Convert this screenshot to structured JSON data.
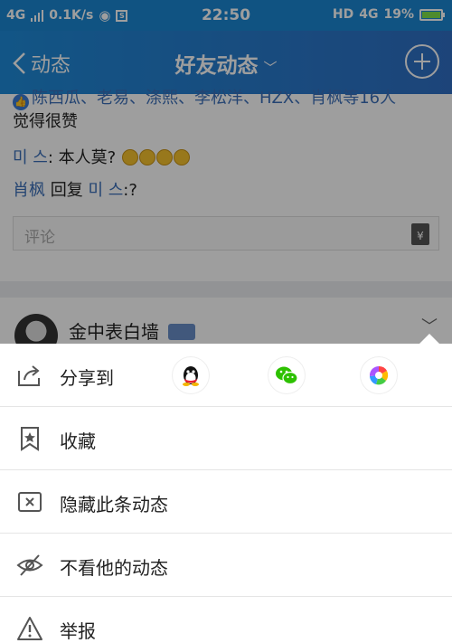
{
  "status_bar": {
    "network": "4G",
    "speed": "0.1K/s",
    "time": "22:50",
    "hd": "HD",
    "network2": "4G",
    "battery": "19%"
  },
  "nav": {
    "back_label": "动态",
    "title": "好友动态"
  },
  "feed": {
    "likes_names": "陈西瓜、老易、涤熙、李松洋、HZX、肖枫等16人",
    "likes_suffix": "觉得很赞",
    "comment1": {
      "user": "미 스",
      "text": ": 本人莫?"
    },
    "comment2": {
      "user": "肖枫",
      "reply_word": " 回复 ",
      "target": "미 스",
      "text": ":?"
    },
    "comment_placeholder": "评论",
    "money_glyph": "¥",
    "post2_name": "金中表白墙"
  },
  "sheet": {
    "share_label": "分享到",
    "items": [
      {
        "label": "收藏",
        "icon": "bookmark-star-icon"
      },
      {
        "label": "隐藏此条动态",
        "icon": "hide-x-icon"
      },
      {
        "label": "不看他的动态",
        "icon": "eye-off-icon"
      },
      {
        "label": "举报",
        "icon": "warning-icon"
      }
    ],
    "share_apps": [
      "qq-icon",
      "wechat-icon",
      "moments-icon"
    ]
  },
  "colors": {
    "nav_blue": "#1e8ad8",
    "link_blue": "#3a6fb8",
    "mask": "rgba(0,0,0,0.38)"
  }
}
